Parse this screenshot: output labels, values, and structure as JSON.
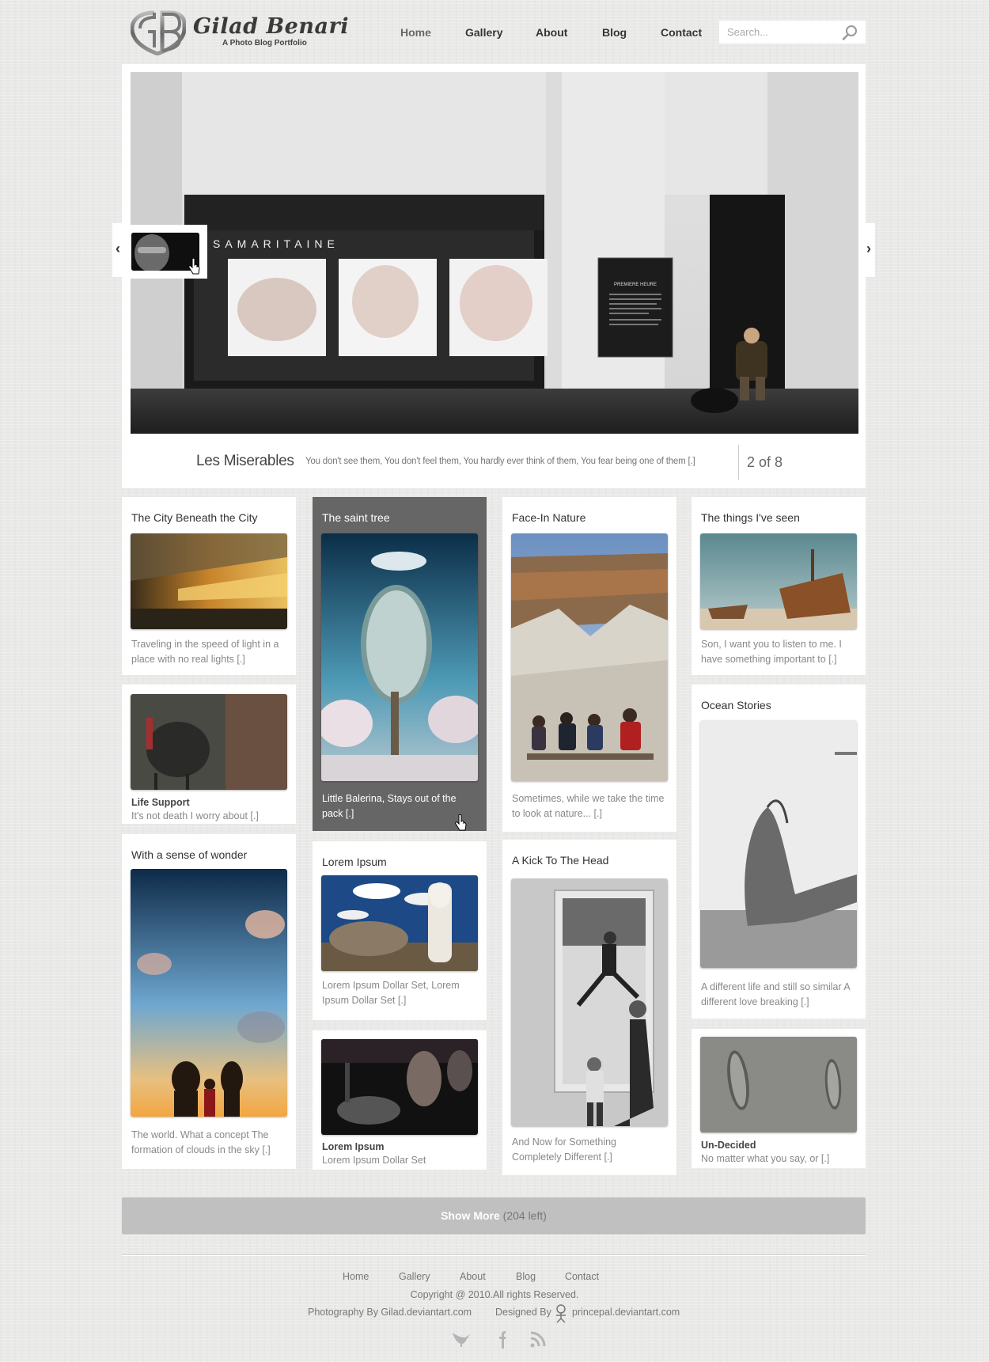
{
  "header": {
    "logo_monogram": "GB",
    "logo_name": "Gilad Benari",
    "logo_tagline": "A Photo Blog Portfolio",
    "nav": [
      {
        "label": "Home",
        "active": true
      },
      {
        "label": "Gallery",
        "active": false
      },
      {
        "label": "About",
        "active": false
      },
      {
        "label": "Blog",
        "active": false
      },
      {
        "label": "Contact",
        "active": false
      }
    ],
    "search_placeholder": "Search..."
  },
  "slider": {
    "sign_text": "SAMARITAINE",
    "poster_title": "PREMIERE HEURE",
    "caption_title": "Les Miserables",
    "caption_text": "You don't see them, You don't feel them, You hardly ever think of them, You fear being one of them [.]",
    "current": 2,
    "total": 8,
    "counter_label": "2 of 8",
    "prev_label": "‹",
    "next_label": "›"
  },
  "cards": [
    {
      "title": "The City Beneath the City",
      "text": "Traveling in the speed of light in a place with no real lights [.]"
    },
    {
      "subtitle": "Life Support",
      "text": "It's not death I worry about [.]"
    },
    {
      "title": "With a sense of wonder",
      "text": "The world. What a concept The formation of clouds in the sky [.]"
    },
    {
      "title": "The saint tree",
      "text": "Little Balerina, Stays out of the pack [.]",
      "highlighted": true
    },
    {
      "title": "Lorem Ipsum",
      "text": "Lorem Ipsum Dollar Set, Lorem Ipsum Dollar Set [.]"
    },
    {
      "subtitle": "Lorem Ipsum",
      "text": "Lorem Ipsum Dollar Set"
    },
    {
      "title": "Face-In Nature",
      "text": "Sometimes, while we take the time to look at nature...  [.]"
    },
    {
      "title": "A Kick To The Head",
      "text": "And Now for Something Completely Different [.]"
    },
    {
      "title": "The things I've seen",
      "text": "Son, I want you to listen to me. I have something important to [.]"
    },
    {
      "title": "Ocean Stories",
      "text": "A different life and still so similar A different love breaking [.]"
    },
    {
      "subtitle": "Un-Decided",
      "text": "No matter what you say, or [.]"
    }
  ],
  "show_more": {
    "label": "Show More",
    "count_text": "(204 left)"
  },
  "footer": {
    "nav": [
      "Home",
      "Gallery",
      "About",
      "Blog",
      "Contact"
    ],
    "copyright": "Copyright @ 2010.All rights Reserved.",
    "photography_credit": "Photography By Gilad.deviantart.com",
    "designed_by_label": "Designed By",
    "designer_link": "princepal.deviantart.com",
    "social": [
      "twitter-icon",
      "facebook-icon",
      "rss-icon"
    ]
  },
  "colors": {
    "background": "#e9e9e8",
    "card": "#ffffff",
    "card_highlight": "#666666",
    "show_more_bar": "#c0c0c0",
    "text_dark": "#333333",
    "text_muted": "#888888"
  }
}
